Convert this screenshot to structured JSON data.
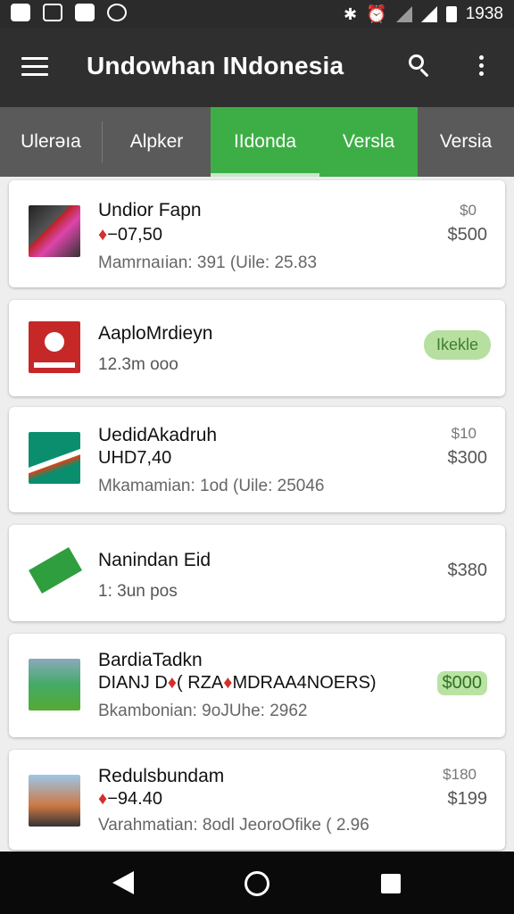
{
  "status_bar": {
    "time": "1938"
  },
  "app_bar": {
    "title": "Undowhan INdonesia"
  },
  "tabs": [
    {
      "label": "Ulerəıa",
      "active": false
    },
    {
      "label": "Alpker",
      "active": false
    },
    {
      "label": "IIdonda",
      "active": true
    },
    {
      "label": "Versla",
      "active": true
    },
    {
      "label": "Versia",
      "active": false
    }
  ],
  "items": [
    {
      "name": "Undior Fapn",
      "sub": "−07,50",
      "meta": "Mamrnaıian: 391 (Uile: 25.83",
      "price_top": "$0",
      "price": "$500"
    },
    {
      "name": "AaploMrdieyn",
      "meta": "12.3m ooo",
      "badge": "Ikekle"
    },
    {
      "name": "UedidAkadruh",
      "sub": "UHD7,40",
      "meta": "Mkamamian: 1od (Uile: 25046",
      "price_top": "$10",
      "price": "$300"
    },
    {
      "name": "Nanindan Eid",
      "meta": "1: 3un pos",
      "price": "$380"
    },
    {
      "name": "BardiaTadkn",
      "sub_a": "DIANJ D",
      "sub_b": "( RZA",
      "sub_c": "MDRAA4NOERS)",
      "meta": "Bkambonian: 9oJUhe: 2962",
      "price": "$000"
    },
    {
      "name": "Redulsbundam",
      "sub": "−94.40",
      "meta": "Varahmatian: 8odl JeoroOfike ( 2.96",
      "price_top": "$180",
      "price": "$199"
    }
  ],
  "colors": {
    "accent": "#3dae45",
    "appbar": "#2f2f2f",
    "tabbar": "#5a5a5a",
    "down_arrow": "#d32f2f"
  }
}
